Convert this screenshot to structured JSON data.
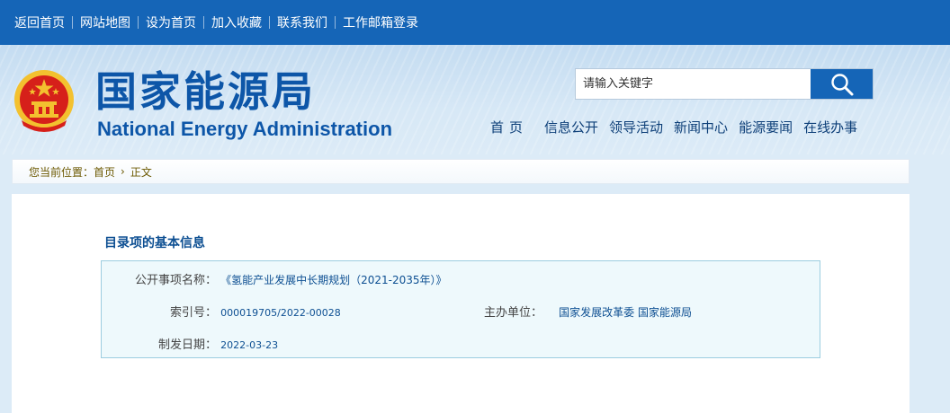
{
  "top_links": [
    "返回首页",
    "网站地图",
    "设为首页",
    "加入收藏",
    "联系我们",
    "工作邮箱登录"
  ],
  "site": {
    "title_cn": "国家能源局",
    "title_en": "National Energy Administration"
  },
  "search": {
    "placeholder": "请输入关键字",
    "button_icon": "search-icon"
  },
  "nav": [
    "首页",
    "信息公开",
    "领导活动",
    "新闻中心",
    "能源要闻",
    "在线办事"
  ],
  "breadcrumb": {
    "prefix": "您当前位置：",
    "items": [
      "首页",
      "正文"
    ]
  },
  "section": {
    "title": "目录项的基本信息"
  },
  "info": {
    "name_label": "公开事项名称：",
    "name_value": "《氢能产业发展中长期规划（2021-2035年）》",
    "index_label": "索引号：",
    "index_value": "000019705/2022-00028",
    "org_label": "主办单位：",
    "org_value": "国家发展改革委 国家能源局",
    "date_label": "制发日期：",
    "date_value": "2022-03-23"
  },
  "colors": {
    "topbar": "#1565b7",
    "brand_blue": "#0d56a8",
    "info_bg": "#eef9fc",
    "emblem_red": "#d6201a",
    "emblem_gold": "#f3c12f"
  }
}
